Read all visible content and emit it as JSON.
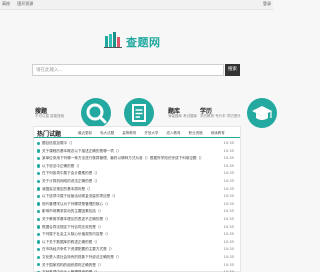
{
  "topbar": {
    "links": [
      "高校",
      "国开资源"
    ],
    "login": "登录"
  },
  "logo": {
    "name": "查题网"
  },
  "search": {
    "placeholder": "请在此输入...",
    "button": "搜索"
  },
  "features": [
    {
      "title": "搜题",
      "sub": "不可以直 智能搜索"
    },
    {
      "title": "题库",
      "sub": "海量题库 考试题库"
    },
    {
      "title": "学历",
      "sub": "学历教育 专升本 学历提升"
    }
  ],
  "hot": {
    "title": "热门试题",
    "tabs": [
      "最近更新",
      "电大试题",
      "高等教育",
      "开放大学",
      "成人教育",
      "职业资格",
      "继续教育"
    ],
    "items": [
      {
        "q": "题目信息加载中（）",
        "t": "10:35"
      },
      {
        "q": "关于课程的基本概念以下描述正确的是哪一项（）",
        "t": "10:35"
      },
      {
        "q": "某单位采用下列哪一种方法进行核算管理，最终以哪种方式为准（）根据所学知识完成下列填空题（）",
        "t": "10:35"
      },
      {
        "q": "以下说法中正确的是（）",
        "t": "10:35"
      },
      {
        "q": "在下列各项中属于会计要素的是（）",
        "t": "10:35"
      },
      {
        "q": "关于计算机网络的说法正确的是（）",
        "t": "10:35"
      },
      {
        "q": "我国宪法规定的基本原则是（）",
        "t": "10:35"
      },
      {
        "q": "以下选项中属于经营活动现金流量的项目是（）",
        "t": "10:35"
      },
      {
        "q": "现代管理学认为下列哪项是管理的核心（）",
        "t": "10:35"
      },
      {
        "q": "影响市场需求变动的主要因素包括（）",
        "t": "10:35"
      },
      {
        "q": "关于教育学基本理论的表述不正确的是（）",
        "t": "10:35"
      },
      {
        "q": "根据合同法规定下列合同无效的是（）",
        "t": "10:35"
      },
      {
        "q": "下列属于社会主义核心价值观的内容是（）",
        "t": "10:35"
      },
      {
        "q": "以下关于数据库的叙述正确的是（）",
        "t": "10:35"
      },
      {
        "q": "在市场经济条件下资源配置的主要方式是（）",
        "t": "10:35"
      },
      {
        "q": "文化是人类社会特有的现象下列说法正确的是（）",
        "t": "10:35"
      },
      {
        "q": "关于国家机构的组织原则正确的是（）",
        "t": "10:35"
      },
      {
        "q": "下列各项中应计入管理费用的是（）",
        "t": "10:35"
      }
    ]
  },
  "colors": {
    "accent": "#23a9a0",
    "button": "#333333"
  }
}
